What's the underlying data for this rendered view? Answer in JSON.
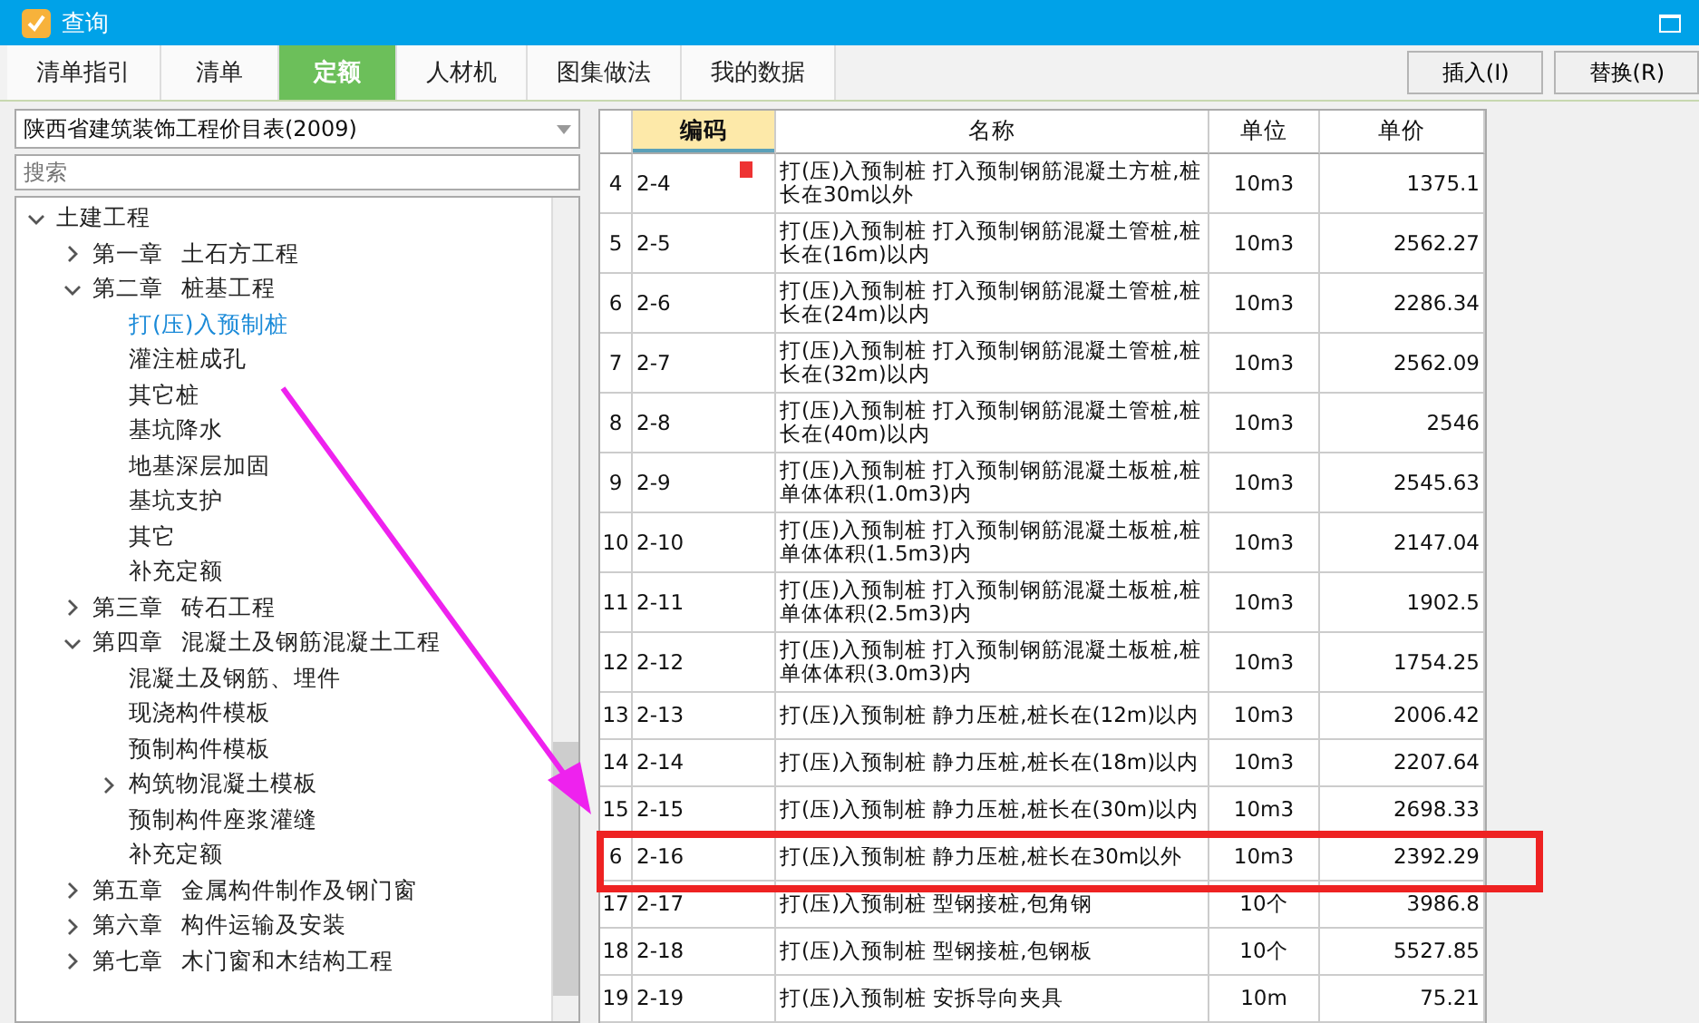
{
  "window": {
    "title": "查询"
  },
  "tabs": [
    {
      "label": "清单指引",
      "selected": false
    },
    {
      "label": "清单",
      "selected": false
    },
    {
      "label": "定额",
      "selected": true
    },
    {
      "label": "人材机",
      "selected": false
    },
    {
      "label": "图集做法",
      "selected": false
    },
    {
      "label": "我的数据",
      "selected": false
    }
  ],
  "buttons": [
    "插入(I)",
    "替换(R)"
  ],
  "library_select": {
    "value": "陕西省建筑装饰工程价目表(2009)"
  },
  "search": {
    "placeholder": "搜索"
  },
  "tree": [
    {
      "label": "土建工程",
      "expanded": true,
      "selected": false,
      "children": [
        {
          "label": "第一章 土石方工程",
          "expanded": false,
          "selected": false
        },
        {
          "label": "第二章 桩基工程",
          "expanded": true,
          "selected": false,
          "children": [
            {
              "label": "打(压)入预制桩",
              "selected": true
            },
            {
              "label": "灌注桩成孔",
              "selected": false
            },
            {
              "label": "其它桩",
              "selected": false
            },
            {
              "label": "基坑降水",
              "selected": false
            },
            {
              "label": "地基深层加固",
              "selected": false
            },
            {
              "label": "基坑支护",
              "selected": false
            },
            {
              "label": "其它",
              "selected": false
            },
            {
              "label": "补充定额",
              "selected": false
            }
          ]
        },
        {
          "label": "第三章 砖石工程",
          "expanded": false,
          "selected": false
        },
        {
          "label": "第四章 混凝土及钢筋混凝土工程",
          "expanded": true,
          "selected": false,
          "children": [
            {
              "label": "混凝土及钢筋、埋件",
              "selected": false
            },
            {
              "label": "现浇构件模板",
              "selected": false
            },
            {
              "label": "预制构件模板",
              "selected": false
            },
            {
              "label": "构筑物混凝土模板",
              "expanded": false,
              "selected": false
            },
            {
              "label": "预制构件座浆灌缝",
              "selected": false
            },
            {
              "label": "补充定额",
              "selected": false
            }
          ]
        },
        {
          "label": "第五章 金属构件制作及钢门窗",
          "expanded": false,
          "selected": false
        },
        {
          "label": "第六章 构件运输及安装",
          "expanded": false,
          "selected": false
        },
        {
          "label": "第七章 木门窗和木结构工程",
          "expanded": false,
          "selected": false
        }
      ]
    }
  ],
  "table": {
    "columns": [
      {
        "label": "编码",
        "selected": true
      },
      {
        "label": "名称",
        "selected": false
      },
      {
        "label": "单位",
        "selected": false
      },
      {
        "label": "单价",
        "selected": false
      }
    ],
    "rows": [
      {
        "no": "4",
        "code": "2-4",
        "name": "打(压)入预制桩 打入预制钢筋混凝土方桩,桩长在30m以外",
        "unit": "10m3",
        "price": "1375.1",
        "marked": true
      },
      {
        "no": "5",
        "code": "2-5",
        "name": "打(压)入预制桩 打入预制钢筋混凝土管桩,桩长在(16m)以内",
        "unit": "10m3",
        "price": "2562.27",
        "marked": false
      },
      {
        "no": "6",
        "code": "2-6",
        "name": "打(压)入预制桩 打入预制钢筋混凝土管桩,桩长在(24m)以内",
        "unit": "10m3",
        "price": "2286.34",
        "marked": false
      },
      {
        "no": "7",
        "code": "2-7",
        "name": "打(压)入预制桩 打入预制钢筋混凝土管桩,桩长在(32m)以内",
        "unit": "10m3",
        "price": "2562.09",
        "marked": false
      },
      {
        "no": "8",
        "code": "2-8",
        "name": "打(压)入预制桩 打入预制钢筋混凝土管桩,桩长在(40m)以内",
        "unit": "10m3",
        "price": "2546",
        "marked": false
      },
      {
        "no": "9",
        "code": "2-9",
        "name": "打(压)入预制桩 打入预制钢筋混凝土板桩,桩单体体积(1.0m3)内",
        "unit": "10m3",
        "price": "2545.63",
        "marked": false
      },
      {
        "no": "10",
        "code": "2-10",
        "name": "打(压)入预制桩 打入预制钢筋混凝土板桩,桩单体体积(1.5m3)内",
        "unit": "10m3",
        "price": "2147.04",
        "marked": false
      },
      {
        "no": "11",
        "code": "2-11",
        "name": "打(压)入预制桩 打入预制钢筋混凝土板桩,桩单体体积(2.5m3)内",
        "unit": "10m3",
        "price": "1902.5",
        "marked": false
      },
      {
        "no": "12",
        "code": "2-12",
        "name": "打(压)入预制桩 打入预制钢筋混凝土板桩,桩单体体积(3.0m3)内",
        "unit": "10m3",
        "price": "1754.25",
        "marked": false
      },
      {
        "no": "13",
        "code": "2-13",
        "name": "打(压)入预制桩 静力压桩,桩长在(12m)以内",
        "unit": "10m3",
        "price": "2006.42",
        "marked": false
      },
      {
        "no": "14",
        "code": "2-14",
        "name": "打(压)入预制桩 静力压桩,桩长在(18m)以内",
        "unit": "10m3",
        "price": "2207.64",
        "marked": false
      },
      {
        "no": "15",
        "code": "2-15",
        "name": "打(压)入预制桩 静力压桩,桩长在(30m)以内",
        "unit": "10m3",
        "price": "2698.33",
        "marked": false
      },
      {
        "no": "6",
        "code": "2-16",
        "name": "打(压)入预制桩 静力压桩,桩长在30m以外",
        "unit": "10m3",
        "price": "2392.29",
        "marked": false
      },
      {
        "no": "17",
        "code": "2-17",
        "name": "打(压)入预制桩 型钢接桩,包角钢",
        "unit": "10个",
        "price": "3986.8",
        "marked": false
      },
      {
        "no": "18",
        "code": "2-18",
        "name": "打(压)入预制桩 型钢接桩,包钢板",
        "unit": "10个",
        "price": "5527.85",
        "marked": false
      },
      {
        "no": "19",
        "code": "2-19",
        "name": "打(压)入预制桩 安拆导向夹具",
        "unit": "10m",
        "price": "75.21",
        "marked": false
      }
    ]
  }
}
